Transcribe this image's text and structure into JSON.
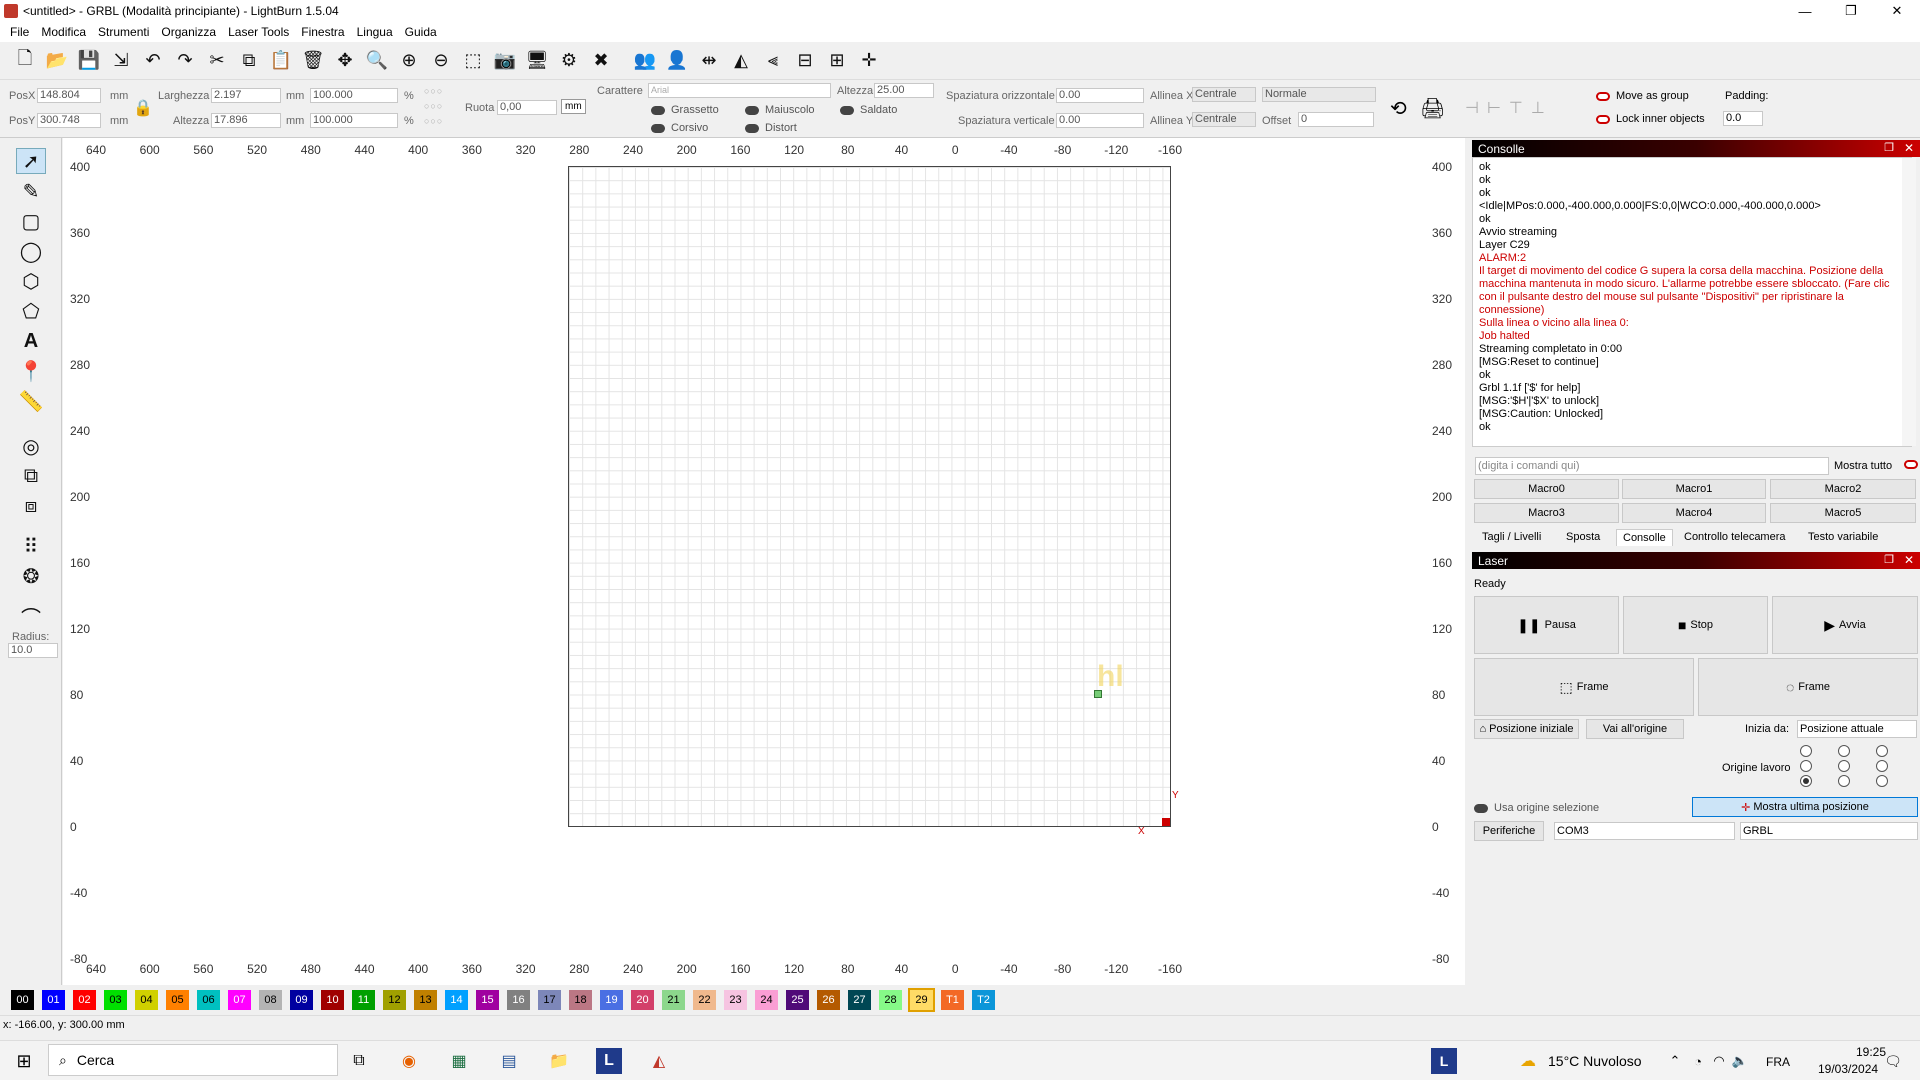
{
  "window": {
    "title": "<untitled> - GRBL (Modalità principiante) - LightBurn 1.5.04",
    "controls": [
      "—",
      "❐",
      "✕"
    ]
  },
  "menu": [
    "File",
    "Modifica",
    "Strumenti",
    "Organizza",
    "Laser Tools",
    "Finestra",
    "Lingua",
    "Guida"
  ],
  "props": {
    "posx_label": "PosX",
    "posx": "148.804",
    "posy_label": "PosY",
    "posy": "300.748",
    "unit": "mm",
    "width_label": "Larghezza",
    "width": "2.197",
    "height_label": "Altezza",
    "height": "17.896",
    "scale_w": "100.000",
    "scale_h": "100.000",
    "pct": "%",
    "rotate_label": "Ruota",
    "rotate": "0,00",
    "rot_unit": "mm",
    "font_label": "Carattere",
    "font": "Arial",
    "font_h_label": "Altezza",
    "font_h": "25.00",
    "bold": "Grassetto",
    "italic": "Corsivo",
    "upper": "Maiuscolo",
    "distort": "Distort",
    "welded": "Saldato",
    "hspace_label": "Spaziatura orizzontale",
    "hspace": "0.00",
    "vspace_label": "Spaziatura verticale",
    "vspace": "0.00",
    "alignx_label": "Allinea X",
    "alignx": "Centrale",
    "aligny_label": "Allinea Y",
    "aligny": "Centrale",
    "normal": "Normale",
    "offset_label": "Offset",
    "offset": "0",
    "move_group": "Move as group",
    "lock_inner": "Lock inner objects",
    "padding_label": "Padding:",
    "padding": "0.0"
  },
  "left": {
    "radius_label": "Radius:",
    "radius": "10.0"
  },
  "ruler": {
    "x": [
      "640",
      "600",
      "560",
      "520",
      "480",
      "440",
      "400",
      "360",
      "320",
      "280",
      "240",
      "200",
      "160",
      "120",
      "80",
      "40",
      "0",
      "-40",
      "-80",
      "-120",
      "-160"
    ],
    "y": [
      "400",
      "360",
      "320",
      "280",
      "240",
      "200",
      "160",
      "120",
      "80",
      "40",
      "0",
      "-40",
      "-80"
    ]
  },
  "canvas": {
    "axis_x": "X",
    "axis_y": "Y"
  },
  "console": {
    "title": "Consolle",
    "lines": [
      {
        "t": "ok",
        "e": false
      },
      {
        "t": "ok",
        "e": false
      },
      {
        "t": "ok",
        "e": false
      },
      {
        "t": "<Idle|MPos:0.000,-400.000,0.000|FS:0,0|WCO:0.000,-400.000,0.000>",
        "e": false
      },
      {
        "t": "ok",
        "e": false
      },
      {
        "t": "Avvio streaming",
        "e": false
      },
      {
        "t": "Layer C29",
        "e": false
      },
      {
        "t": "ALARM:2",
        "e": true
      },
      {
        "t": "Il target di movimento del codice G supera la corsa della macchina. Posizione della macchina mantenuta in modo sicuro. L'allarme potrebbe essere sbloccato. (Fare clic con il pulsante destro del mouse sul pulsante \"Dispositivi\" per ripristinare la connessione)",
        "e": true
      },
      {
        "t": "Sulla linea o vicino alla linea 0:",
        "e": true
      },
      {
        "t": "Job halted",
        "e": true
      },
      {
        "t": "Streaming completato in 0:00",
        "e": false
      },
      {
        "t": "[MSG:Reset to continue]",
        "e": false
      },
      {
        "t": "ok",
        "e": false
      },
      {
        "t": "Grbl 1.1f ['$' for help]",
        "e": false
      },
      {
        "t": "[MSG:'$H'|'$X' to unlock]",
        "e": false
      },
      {
        "t": "[MSG:Caution: Unlocked]",
        "e": false
      },
      {
        "t": "ok",
        "e": false
      }
    ],
    "input_placeholder": "(digita i comandi qui)",
    "show_all": "Mostra tutto",
    "macros": [
      "Macro0",
      "Macro1",
      "Macro2",
      "Macro3",
      "Macro4",
      "Macro5"
    ],
    "tabs": [
      "Tagli / Livelli",
      "Sposta",
      "Consolle",
      "Controllo telecamera",
      "Testo variabile"
    ]
  },
  "laser": {
    "title": "Laser",
    "status": "Ready",
    "pause": "Pausa",
    "stop": "Stop",
    "start": "Avvia",
    "frame1": "Frame",
    "frame2": "Frame",
    "home": "Posizione iniziale",
    "origin": "Vai all'origine",
    "start_from_label": "Inizia da:",
    "start_from": "Posizione attuale",
    "job_origin": "Origine lavoro",
    "use_sel": "Usa origine selezione",
    "show_last": "Mostra ultima posizione",
    "devices": "Periferiche",
    "port": "COM3",
    "device": "GRBL"
  },
  "palette": [
    {
      "n": "00",
      "c": "#000000",
      "f": "#ffffff"
    },
    {
      "n": "01",
      "c": "#0000ff",
      "f": "#ffffff"
    },
    {
      "n": "02",
      "c": "#ff0000",
      "f": "#ffffff"
    },
    {
      "n": "03",
      "c": "#00e000",
      "f": "#000000"
    },
    {
      "n": "04",
      "c": "#d0d000",
      "f": "#000000"
    },
    {
      "n": "05",
      "c": "#ff8000",
      "f": "#000000"
    },
    {
      "n": "06",
      "c": "#00c0c0",
      "f": "#000000"
    },
    {
      "n": "07",
      "c": "#ff00ff",
      "f": "#ffffff"
    },
    {
      "n": "08",
      "c": "#b4b4b4",
      "f": "#000000"
    },
    {
      "n": "09",
      "c": "#0000a0",
      "f": "#ffffff"
    },
    {
      "n": "10",
      "c": "#a00000",
      "f": "#ffffff"
    },
    {
      "n": "11",
      "c": "#00a000",
      "f": "#ffffff"
    },
    {
      "n": "12",
      "c": "#a0a000",
      "f": "#000000"
    },
    {
      "n": "13",
      "c": "#c08000",
      "f": "#000000"
    },
    {
      "n": "14",
      "c": "#00a0ff",
      "f": "#ffffff"
    },
    {
      "n": "15",
      "c": "#a000a0",
      "f": "#ffffff"
    },
    {
      "n": "16",
      "c": "#808080",
      "f": "#ffffff"
    },
    {
      "n": "17",
      "c": "#7d87b9",
      "f": "#000000"
    },
    {
      "n": "18",
      "c": "#bb7784",
      "f": "#000000"
    },
    {
      "n": "19",
      "c": "#4a6fe3",
      "f": "#ffffff"
    },
    {
      "n": "20",
      "c": "#d33f6a",
      "f": "#ffffff"
    },
    {
      "n": "21",
      "c": "#8cd78c",
      "f": "#000000"
    },
    {
      "n": "22",
      "c": "#f0b98d",
      "f": "#000000"
    },
    {
      "n": "23",
      "c": "#f6c4e1",
      "f": "#000000"
    },
    {
      "n": "24",
      "c": "#fa9ed4",
      "f": "#000000"
    },
    {
      "n": "25",
      "c": "#500a78",
      "f": "#ffffff"
    },
    {
      "n": "26",
      "c": "#b45a00",
      "f": "#ffffff"
    },
    {
      "n": "27",
      "c": "#004754",
      "f": "#ffffff"
    },
    {
      "n": "28",
      "c": "#86fa88",
      "f": "#000000"
    },
    {
      "n": "29",
      "c": "#ffdb66",
      "f": "#000000"
    },
    {
      "n": "T1",
      "c": "#f36926",
      "f": "#ffffff"
    },
    {
      "n": "T2",
      "c": "#0c96d9",
      "f": "#ffffff"
    }
  ],
  "status": "x: -166.00, y: 300.00 mm",
  "taskbar": {
    "search": "Cerca",
    "weather": "15°C  Nuvoloso",
    "lang": "FRA",
    "time": "19:25",
    "date": "19/03/2024"
  }
}
